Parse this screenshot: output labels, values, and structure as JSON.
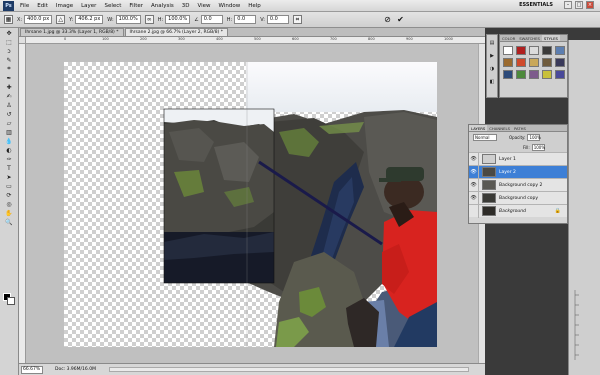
{
  "app": {
    "logo": "Ps",
    "menu": [
      "File",
      "Edit",
      "Image",
      "Layer",
      "Select",
      "Filter",
      "Analysis",
      "3D",
      "View",
      "Window",
      "Help"
    ],
    "workspace_label": "ESSENTIALS",
    "win_buttons": [
      "–",
      "□",
      "×"
    ]
  },
  "options_bar": {
    "x": "400.0 px",
    "y": "406.2 px",
    "w": "100.0%",
    "h": "100.0%",
    "angle": "0.0",
    "h_skew": "0.0",
    "v_skew": "0.0",
    "cancel_icon": "cancel-transform-icon",
    "commit_icon": "commit-transform-icon"
  },
  "tabs": [
    {
      "label": "Ihrsane 1.jpg @ 33.3% (Layer 1, RGB/8) *",
      "active": false
    },
    {
      "label": "Ihrsane 2.jpg @ 66.7% (Layer 2, RGB/8) *",
      "active": true
    }
  ],
  "ruler_labels": [
    "0",
    "100",
    "200",
    "300",
    "400",
    "500",
    "600",
    "700",
    "800",
    "900",
    "1000"
  ],
  "status": {
    "zoom": "66.67%",
    "doc": "Doc: 3.96M/16.0M"
  },
  "panels": {
    "styles_tabs": [
      "COLOR",
      "SWATCHES",
      "STYLES"
    ],
    "styles_colors": [
      "#ffffff",
      "#b02020",
      "#dcdcdc",
      "#3b3b3b",
      "#5c7eb0",
      "#9b6a2e",
      "#cf4a2c",
      "#c9a85a",
      "#6f5b3c",
      "#3a3a5a",
      "#2c4a7a",
      "#4d8a3b",
      "#7d5b8c",
      "#c8c03a",
      "#4a4a9a"
    ],
    "layers_tabs": [
      "LAYERS",
      "CHANNELS",
      "PATHS"
    ],
    "blend_mode": "Normal",
    "opacity_label": "Opacity:",
    "opacity": "100%",
    "fill_label": "Fill:",
    "fill": "100%",
    "layers": [
      {
        "name": "Layer 1",
        "selected": false,
        "visible": true,
        "locked": false
      },
      {
        "name": "Layer 2",
        "selected": true,
        "visible": true,
        "locked": false
      },
      {
        "name": "Background copy 2",
        "selected": false,
        "visible": true,
        "locked": false
      },
      {
        "name": "Background copy",
        "selected": false,
        "visible": true,
        "locked": false
      },
      {
        "name": "Background",
        "selected": false,
        "visible": false,
        "locked": true
      }
    ]
  },
  "colors": {
    "selection": "#3d7fd6",
    "shirt": "#d8231f",
    "workspace": "#c0c0c0"
  }
}
